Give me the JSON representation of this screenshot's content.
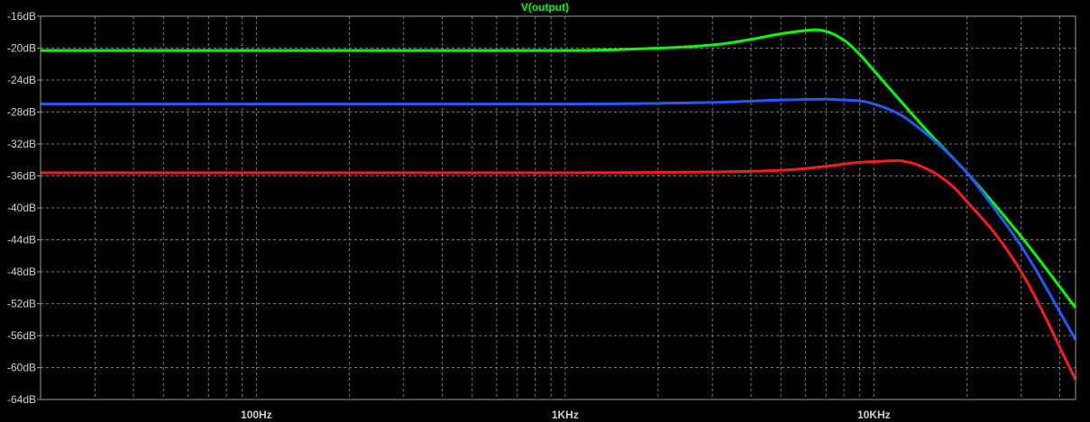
{
  "chart_data": {
    "type": "line",
    "title": "V(output)",
    "x_scale": "log",
    "xlim": [
      20,
      45000
    ],
    "ylim": [
      -64,
      -16
    ],
    "y_unit": "dB",
    "grid": true,
    "x_ticks": [
      {
        "value": 100,
        "label": "100Hz"
      },
      {
        "value": 1000,
        "label": "1KHz"
      },
      {
        "value": 10000,
        "label": "10KHz"
      }
    ],
    "y_ticks": [
      {
        "value": -16,
        "label": "-16dB"
      },
      {
        "value": -20,
        "label": "-20dB"
      },
      {
        "value": -24,
        "label": "-24dB"
      },
      {
        "value": -28,
        "label": "-28dB"
      },
      {
        "value": -32,
        "label": "-32dB"
      },
      {
        "value": -36,
        "label": "-36dB"
      },
      {
        "value": -40,
        "label": "-40dB"
      },
      {
        "value": -44,
        "label": "-44dB"
      },
      {
        "value": -48,
        "label": "-48dB"
      },
      {
        "value": -52,
        "label": "-52dB"
      },
      {
        "value": -56,
        "label": "-56dB"
      },
      {
        "value": -60,
        "label": "-60dB"
      },
      {
        "value": -64,
        "label": "-64dB"
      }
    ],
    "series": [
      {
        "color": "#00ff00",
        "x": [
          20,
          100,
          1000,
          2000,
          3000,
          4000,
          5000,
          6000,
          6500,
          7000,
          8000,
          9000,
          10000,
          12000,
          15000,
          20000,
          30000,
          45000
        ],
        "y": [
          -20.3,
          -20.3,
          -20.3,
          -20.0,
          -19.6,
          -18.9,
          -18.2,
          -17.8,
          -17.7,
          -17.9,
          -19.0,
          -20.8,
          -22.8,
          -26.3,
          -30.5,
          -35.6,
          -43.6,
          -52.5
        ]
      },
      {
        "color": "#1e5aff",
        "x": [
          20,
          100,
          1000,
          3000,
          5000,
          7000,
          8000,
          9000,
          10000,
          12000,
          14000,
          17000,
          20000,
          25000,
          30000,
          45000
        ],
        "y": [
          -27.0,
          -27.0,
          -27.0,
          -26.8,
          -26.5,
          -26.4,
          -26.5,
          -26.6,
          -27.0,
          -28.2,
          -30.0,
          -32.8,
          -35.6,
          -40.5,
          -44.8,
          -56.5
        ]
      },
      {
        "color": "#ff1a1a",
        "x": [
          20,
          100,
          1000,
          3000,
          5000,
          7000,
          9000,
          10000,
          12000,
          13000,
          15000,
          18000,
          20000,
          25000,
          30000,
          45000
        ],
        "y": [
          -35.6,
          -35.6,
          -35.6,
          -35.5,
          -35.3,
          -34.8,
          -34.3,
          -34.2,
          -34.1,
          -34.3,
          -35.2,
          -37.3,
          -39.2,
          -43.5,
          -48.0,
          -61.5
        ]
      }
    ]
  }
}
